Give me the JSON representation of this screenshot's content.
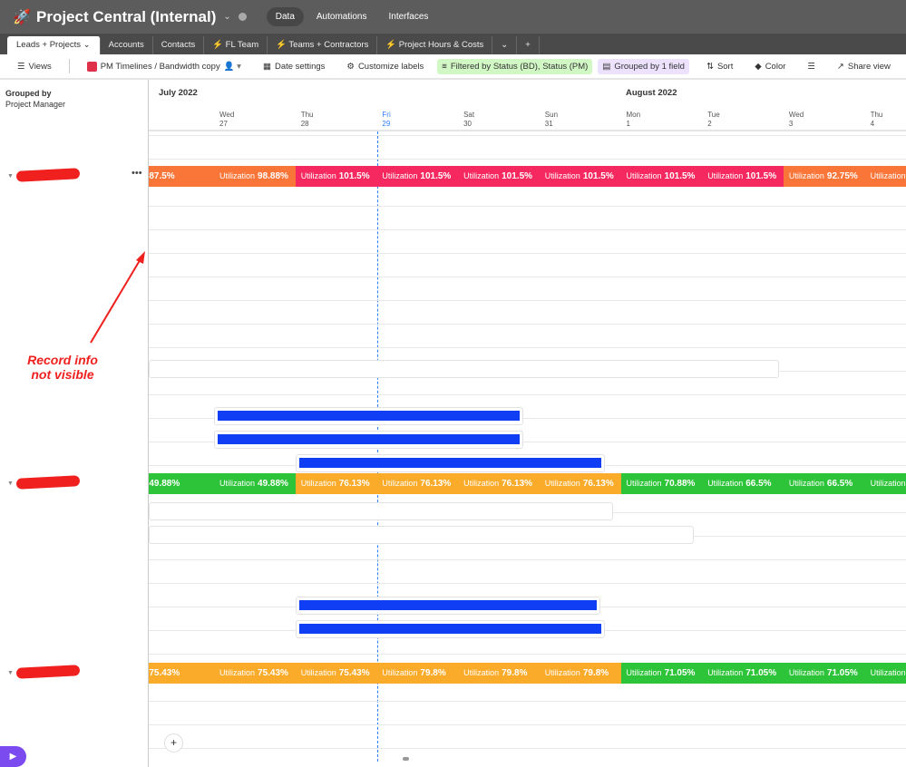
{
  "app": {
    "title": "Project Central (Internal)",
    "nav": [
      "Data",
      "Automations",
      "Interfaces"
    ],
    "active_nav": "Data"
  },
  "tables": [
    {
      "label": "Leads + Projects ⌄",
      "active": true
    },
    {
      "label": "Accounts"
    },
    {
      "label": "Contacts"
    },
    {
      "label": "⚡ FL Team"
    },
    {
      "label": "⚡ Teams + Contractors"
    },
    {
      "label": "⚡ Project Hours & Costs"
    },
    {
      "label": "⌄"
    },
    {
      "label": "+"
    }
  ],
  "toolbar": {
    "views": "Views",
    "view_name": "PM Timelines / Bandwidth copy",
    "date_settings": "Date settings",
    "customize_labels": "Customize labels",
    "filter": "Filtered by Status (BD), Status (PM)",
    "group": "Grouped by 1 field",
    "sort": "Sort",
    "color": "Color",
    "share": "Share view"
  },
  "left_header": {
    "label": "Grouped by",
    "field": "Project Manager"
  },
  "months": [
    {
      "label": "July 2022"
    },
    {
      "label": "August 2022"
    }
  ],
  "days": [
    {
      "dow": "Wed",
      "num": "27"
    },
    {
      "dow": "Thu",
      "num": "28"
    },
    {
      "dow": "Fri",
      "num": "29",
      "today": true
    },
    {
      "dow": "Sat",
      "num": "30"
    },
    {
      "dow": "Sun",
      "num": "31"
    },
    {
      "dow": "Mon",
      "num": "1"
    },
    {
      "dow": "Tue",
      "num": "2"
    },
    {
      "dow": "Wed",
      "num": "3"
    },
    {
      "dow": "Thu",
      "num": "4"
    }
  ],
  "colors": {
    "over": "#f5285f",
    "high": "#f97538",
    "mid": "#fbab2a",
    "low": "#2ec43a",
    "bar": "#0f3ef5",
    "today": "#2d7ff9"
  },
  "utilization_label": "Utilization",
  "groups": [
    {
      "name_redacted": true,
      "cells": [
        [
          "87.5%",
          "high"
        ],
        [
          "98.88%",
          "high"
        ],
        [
          "101.5%",
          "over"
        ],
        [
          "101.5%",
          "over"
        ],
        [
          "101.5%",
          "over"
        ],
        [
          "101.5%",
          "over"
        ],
        [
          "101.5%",
          "over"
        ],
        [
          "101.5%",
          "over"
        ],
        [
          "92.75%",
          "high"
        ],
        [
          "",
          "high"
        ]
      ],
      "records": [
        {
          "start_day": -0.8,
          "end_day": 6.95,
          "bar": false,
          "row": 9
        },
        {
          "start_day": 0,
          "end_day": 3.8,
          "bar": true,
          "row": 11
        },
        {
          "start_day": 0,
          "end_day": 3.8,
          "bar": true,
          "row": 12
        },
        {
          "start_day": 1,
          "end_day": 4.8,
          "bar": true,
          "row": 13
        }
      ]
    },
    {
      "name_redacted": true,
      "cells": [
        [
          "49.88%",
          "low"
        ],
        [
          "49.88%",
          "low"
        ],
        [
          "76.13%",
          "mid"
        ],
        [
          "76.13%",
          "mid"
        ],
        [
          "76.13%",
          "mid"
        ],
        [
          "76.13%",
          "mid"
        ],
        [
          "70.88%",
          "low"
        ],
        [
          "66.5%",
          "low"
        ],
        [
          "66.5%",
          "low"
        ],
        [
          "",
          "low"
        ]
      ],
      "records": [
        {
          "start_day": -0.8,
          "end_day": 4.9,
          "bar": false,
          "row": 2
        },
        {
          "start_day": -0.8,
          "end_day": 5.9,
          "bar": false,
          "row": 3
        },
        {
          "start_day": 1,
          "end_day": 4.75,
          "bar": true,
          "row": 6
        },
        {
          "start_day": 1,
          "end_day": 4.8,
          "bar": true,
          "row": 7
        }
      ]
    },
    {
      "name_redacted": true,
      "cells": [
        [
          "75.43%",
          "mid"
        ],
        [
          "75.43%",
          "mid"
        ],
        [
          "75.43%",
          "mid"
        ],
        [
          "79.8%",
          "mid"
        ],
        [
          "79.8%",
          "mid"
        ],
        [
          "79.8%",
          "mid"
        ],
        [
          "71.05%",
          "low"
        ],
        [
          "71.05%",
          "low"
        ],
        [
          "71.05%",
          "low"
        ],
        [
          "",
          "low"
        ]
      ],
      "records": []
    }
  ],
  "annotation": "Record info not visible",
  "add_label": "+"
}
